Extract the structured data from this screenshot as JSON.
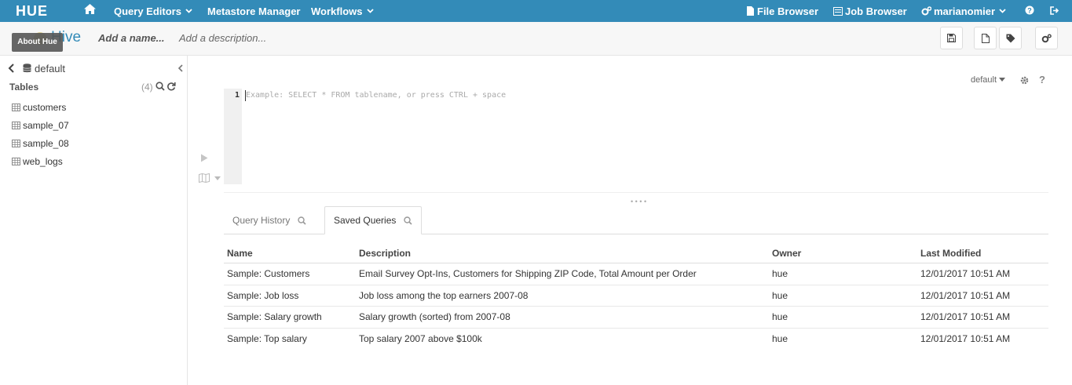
{
  "colors": {
    "nav_bg": "#338bb8",
    "accent": "#338bb8"
  },
  "nav": {
    "logo": "HUE",
    "query_editors": "Query Editors",
    "metastore": "Metastore Manager",
    "workflows": "Workflows",
    "file_browser": "File Browser",
    "job_browser": "Job Browser",
    "user": "marianomier"
  },
  "editor_header": {
    "app_name": "Hive",
    "tooltip": "About Hue",
    "name_placeholder": "Add a name...",
    "desc_placeholder": "Add a description..."
  },
  "assist": {
    "database": "default",
    "tables_label": "Tables",
    "tables_count": "(4)",
    "tables": [
      "customers",
      "sample_07",
      "sample_08",
      "web_logs"
    ]
  },
  "snippet": {
    "database": "default",
    "line_number": "1",
    "placeholder": "Example: SELECT * FROM tablename, or press CTRL + space",
    "help": "?"
  },
  "tabs": {
    "history": "Query History",
    "saved": "Saved Queries"
  },
  "saved_queries": {
    "headers": [
      "Name",
      "Description",
      "Owner",
      "Last Modified"
    ],
    "rows": [
      [
        "Sample: Customers",
        "Email Survey Opt-Ins, Customers for Shipping ZIP Code, Total Amount per Order",
        "hue",
        "12/01/2017 10:51 AM"
      ],
      [
        "Sample: Job loss",
        "Job loss among the top earners 2007-08",
        "hue",
        "12/01/2017 10:51 AM"
      ],
      [
        "Sample: Salary growth",
        "Salary growth (sorted) from 2007-08",
        "hue",
        "12/01/2017 10:51 AM"
      ],
      [
        "Sample: Top salary",
        "Top salary 2007 above $100k",
        "hue",
        "12/01/2017 10:51 AM"
      ]
    ]
  }
}
